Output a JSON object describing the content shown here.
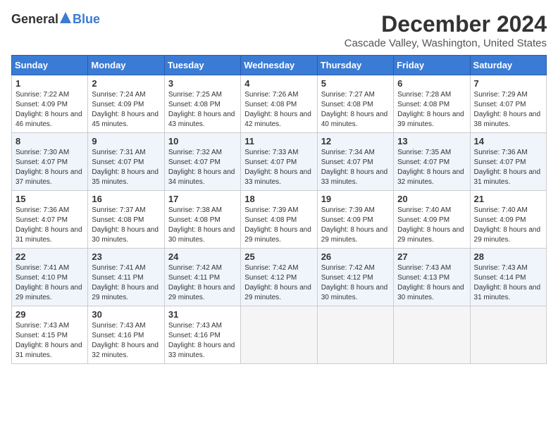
{
  "header": {
    "logo_general": "General",
    "logo_blue": "Blue",
    "month_title": "December 2024",
    "location": "Cascade Valley, Washington, United States"
  },
  "days_of_week": [
    "Sunday",
    "Monday",
    "Tuesday",
    "Wednesday",
    "Thursday",
    "Friday",
    "Saturday"
  ],
  "weeks": [
    [
      {
        "day": "1",
        "sunrise": "7:22 AM",
        "sunset": "4:09 PM",
        "daylight": "8 hours and 46 minutes."
      },
      {
        "day": "2",
        "sunrise": "7:24 AM",
        "sunset": "4:09 PM",
        "daylight": "8 hours and 45 minutes."
      },
      {
        "day": "3",
        "sunrise": "7:25 AM",
        "sunset": "4:08 PM",
        "daylight": "8 hours and 43 minutes."
      },
      {
        "day": "4",
        "sunrise": "7:26 AM",
        "sunset": "4:08 PM",
        "daylight": "8 hours and 42 minutes."
      },
      {
        "day": "5",
        "sunrise": "7:27 AM",
        "sunset": "4:08 PM",
        "daylight": "8 hours and 40 minutes."
      },
      {
        "day": "6",
        "sunrise": "7:28 AM",
        "sunset": "4:08 PM",
        "daylight": "8 hours and 39 minutes."
      },
      {
        "day": "7",
        "sunrise": "7:29 AM",
        "sunset": "4:07 PM",
        "daylight": "8 hours and 38 minutes."
      }
    ],
    [
      {
        "day": "8",
        "sunrise": "7:30 AM",
        "sunset": "4:07 PM",
        "daylight": "8 hours and 37 minutes."
      },
      {
        "day": "9",
        "sunrise": "7:31 AM",
        "sunset": "4:07 PM",
        "daylight": "8 hours and 35 minutes."
      },
      {
        "day": "10",
        "sunrise": "7:32 AM",
        "sunset": "4:07 PM",
        "daylight": "8 hours and 34 minutes."
      },
      {
        "day": "11",
        "sunrise": "7:33 AM",
        "sunset": "4:07 PM",
        "daylight": "8 hours and 33 minutes."
      },
      {
        "day": "12",
        "sunrise": "7:34 AM",
        "sunset": "4:07 PM",
        "daylight": "8 hours and 33 minutes."
      },
      {
        "day": "13",
        "sunrise": "7:35 AM",
        "sunset": "4:07 PM",
        "daylight": "8 hours and 32 minutes."
      },
      {
        "day": "14",
        "sunrise": "7:36 AM",
        "sunset": "4:07 PM",
        "daylight": "8 hours and 31 minutes."
      }
    ],
    [
      {
        "day": "15",
        "sunrise": "7:36 AM",
        "sunset": "4:07 PM",
        "daylight": "8 hours and 31 minutes."
      },
      {
        "day": "16",
        "sunrise": "7:37 AM",
        "sunset": "4:08 PM",
        "daylight": "8 hours and 30 minutes."
      },
      {
        "day": "17",
        "sunrise": "7:38 AM",
        "sunset": "4:08 PM",
        "daylight": "8 hours and 30 minutes."
      },
      {
        "day": "18",
        "sunrise": "7:39 AM",
        "sunset": "4:08 PM",
        "daylight": "8 hours and 29 minutes."
      },
      {
        "day": "19",
        "sunrise": "7:39 AM",
        "sunset": "4:09 PM",
        "daylight": "8 hours and 29 minutes."
      },
      {
        "day": "20",
        "sunrise": "7:40 AM",
        "sunset": "4:09 PM",
        "daylight": "8 hours and 29 minutes."
      },
      {
        "day": "21",
        "sunrise": "7:40 AM",
        "sunset": "4:09 PM",
        "daylight": "8 hours and 29 minutes."
      }
    ],
    [
      {
        "day": "22",
        "sunrise": "7:41 AM",
        "sunset": "4:10 PM",
        "daylight": "8 hours and 29 minutes."
      },
      {
        "day": "23",
        "sunrise": "7:41 AM",
        "sunset": "4:11 PM",
        "daylight": "8 hours and 29 minutes."
      },
      {
        "day": "24",
        "sunrise": "7:42 AM",
        "sunset": "4:11 PM",
        "daylight": "8 hours and 29 minutes."
      },
      {
        "day": "25",
        "sunrise": "7:42 AM",
        "sunset": "4:12 PM",
        "daylight": "8 hours and 29 minutes."
      },
      {
        "day": "26",
        "sunrise": "7:42 AM",
        "sunset": "4:12 PM",
        "daylight": "8 hours and 30 minutes."
      },
      {
        "day": "27",
        "sunrise": "7:43 AM",
        "sunset": "4:13 PM",
        "daylight": "8 hours and 30 minutes."
      },
      {
        "day": "28",
        "sunrise": "7:43 AM",
        "sunset": "4:14 PM",
        "daylight": "8 hours and 31 minutes."
      }
    ],
    [
      {
        "day": "29",
        "sunrise": "7:43 AM",
        "sunset": "4:15 PM",
        "daylight": "8 hours and 31 minutes."
      },
      {
        "day": "30",
        "sunrise": "7:43 AM",
        "sunset": "4:16 PM",
        "daylight": "8 hours and 32 minutes."
      },
      {
        "day": "31",
        "sunrise": "7:43 AM",
        "sunset": "4:16 PM",
        "daylight": "8 hours and 33 minutes."
      },
      null,
      null,
      null,
      null
    ]
  ]
}
